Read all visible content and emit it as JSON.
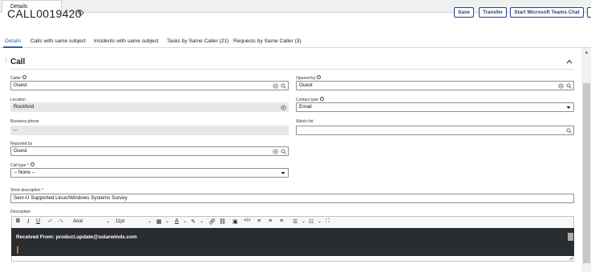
{
  "window": {
    "tab_label": "Details"
  },
  "header": {
    "record_number": "CALL0019420",
    "buttons": {
      "save": "Save",
      "transfer": "Transfer",
      "teams_chat": "Start Microsoft Teams Chat"
    }
  },
  "subtabs": [
    {
      "label": "Details"
    },
    {
      "label": "Calls with same subject"
    },
    {
      "label": "Incidents with same subject"
    },
    {
      "label": "Tasks by Same Caller (21)"
    },
    {
      "label": "Requests by Same Caller (3)"
    }
  ],
  "section": {
    "title": "Call"
  },
  "form": {
    "caller": {
      "label": "Caller",
      "value": "Guest"
    },
    "opened_by": {
      "label": "Opened by",
      "value": "Guest"
    },
    "location": {
      "label": "Location",
      "value": "Rockford"
    },
    "contact_type": {
      "label": "Contact type",
      "value": "Email"
    },
    "business_phone": {
      "label": "Business phone",
      "value": "--"
    },
    "watch_list": {
      "label": "Watch list",
      "value": ""
    },
    "reported_by": {
      "label": "Reported by",
      "value": "Guest"
    },
    "call_type": {
      "label": "Call type",
      "required_mark": "*",
      "value": "-- None --"
    },
    "short_description": {
      "label": "Short description",
      "required_mark": "*",
      "value": "Serv-U Supported Linux/Windows Systems Survey"
    },
    "description": {
      "label": "Description"
    }
  },
  "editor": {
    "font_family": "Arial",
    "font_size": "11pt",
    "content": "Received From: product.update@solarwinds.com"
  },
  "colors": {
    "primary": "#2a3f87",
    "editor_bg": "#2a2d30",
    "readonly_bg": "#e5e7e9"
  }
}
